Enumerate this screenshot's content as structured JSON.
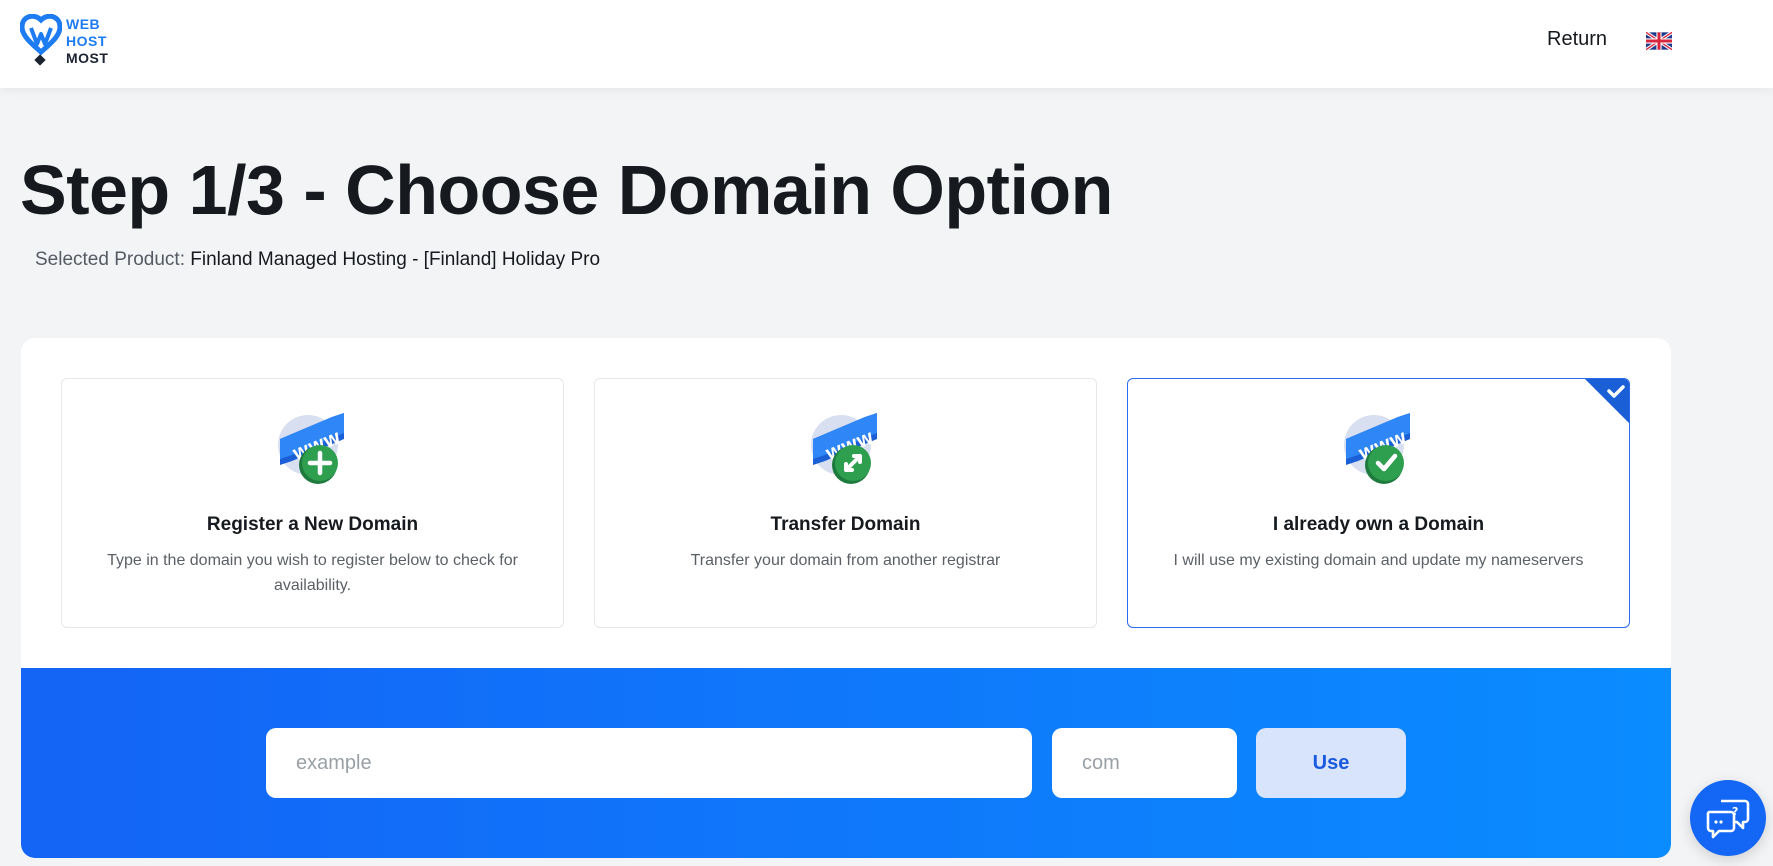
{
  "header": {
    "logo": {
      "line1": "WEB",
      "line2": "HOST",
      "line3": "MOST"
    },
    "return_label": "Return",
    "language_icon": "uk-flag-icon"
  },
  "page": {
    "title": "Step 1/3 - Choose Domain Option",
    "selected_product_label": "Selected Product:",
    "selected_product_value": "Finland Managed Hosting - [Finland] Holiday Pro"
  },
  "options": [
    {
      "title": "Register a New Domain",
      "description": "Type in the domain you wish to register below to check for availability.",
      "icon": "www-plus-icon",
      "selected": false
    },
    {
      "title": "Transfer Domain",
      "description": "Transfer your domain from another registrar",
      "icon": "www-transfer-icon",
      "selected": false
    },
    {
      "title": "I already own a Domain",
      "description": "I will use my existing domain and update my nameservers",
      "icon": "www-check-icon",
      "selected": true
    }
  ],
  "search": {
    "domain_placeholder": "example",
    "tld_placeholder": "com",
    "button_label": "Use"
  },
  "colors": {
    "accent": "#1466f5",
    "gradient_start": "#1464f6",
    "gradient_end": "#0a8cff",
    "success_green": "#2e9e4f",
    "selected_border": "#2a6bf0"
  },
  "chat": {
    "icon": "chat-help-icon"
  }
}
